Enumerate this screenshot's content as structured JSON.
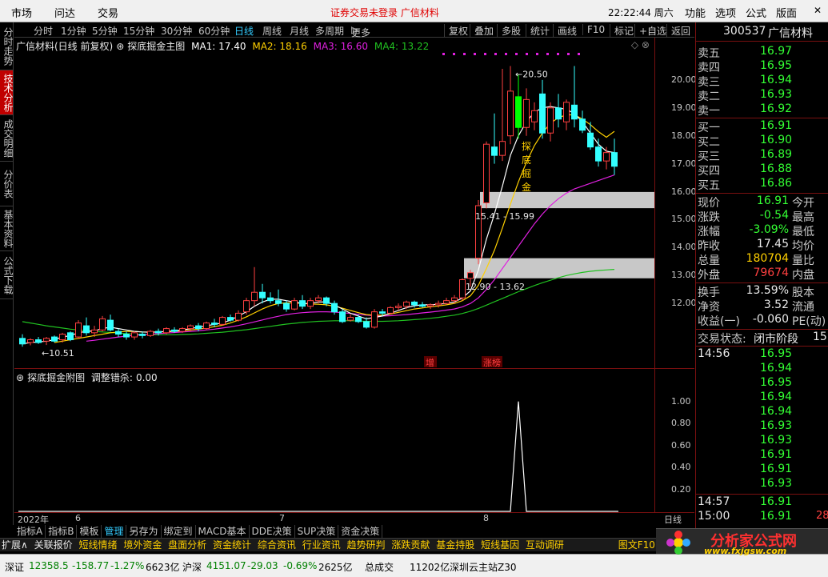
{
  "menu": {
    "items": [
      "市场",
      "问达",
      "交易"
    ],
    "notice": "证券交易未登录",
    "notice_stock": "广信材料",
    "clock": "22:22:44 周六",
    "right_items": [
      "功能",
      "选项",
      "公式",
      "版面"
    ]
  },
  "periods": [
    "分时",
    "1分钟",
    "5分钟",
    "15分钟",
    "30分钟",
    "60分钟",
    "日线",
    "周线",
    "月线",
    "多周期",
    "更多"
  ],
  "period_active": "日线",
  "toolbar_btns": [
    "复权",
    "叠加",
    "多股",
    "统计",
    "画线",
    "F10",
    "标记",
    "+自选",
    "返回"
  ],
  "left_tabs": [
    "分时走势",
    "技术分析",
    "成交明细",
    "分价表",
    "基本资料",
    "公式下载"
  ],
  "left_tab_active": "技术分析",
  "main_legend": {
    "title": "广信材料(日线 前复权)",
    "formula": "探底掘金主图",
    "ma1": "MA1: 17.40",
    "ma2": "MA2: 18.16",
    "ma3": "MA3: 16.60",
    "ma4": "MA4: 13.22"
  },
  "sub_legend": {
    "formula": "探底掘金附图",
    "value_label": "调整错杀:",
    "value": "0.00"
  },
  "annotations": {
    "high": "20.50",
    "low": "10.51",
    "band1": "15.41 - 15.99",
    "band2": "12.90 - 13.62",
    "signal": "探底掘金",
    "tag_zeng": "增",
    "tag_zhangbang": "涨榜"
  },
  "price_axis": [
    "20.00",
    "19.00",
    "18.00",
    "17.00",
    "16.00",
    "15.00",
    "14.00",
    "13.00",
    "12.00"
  ],
  "sub_axis": [
    "1.00",
    "0.80",
    "0.60",
    "0.40",
    "0.20"
  ],
  "date_axis": {
    "year": "2022年",
    "m6": "6",
    "m7": "7",
    "m8": "8",
    "period": "日线"
  },
  "index_tabs": [
    "指标A",
    "指标B",
    "模板",
    "管理",
    "另存为",
    "绑定到",
    "MACD基本",
    "DDE决策",
    "SUP决策",
    "资金决策"
  ],
  "index_tab_active": "管理",
  "info_tabs": [
    "扩展∧",
    "关联报价",
    "短线情绪",
    "境外资金",
    "盘面分析",
    "资金统计",
    "综合资讯",
    "行业资讯",
    "趋势研判",
    "涨跌贡献",
    "基金持股",
    "短线基因",
    "互动调研",
    "图文F10"
  ],
  "status": {
    "sz": "深证",
    "sz_val": "12358.5",
    "sz_chg": "-158.77",
    "sz_pct": "-1.27%",
    "sz_amt": "6623亿",
    "hs": "沪深",
    "hs_val": "4151.07",
    "hs_chg": "-29.03",
    "hs_pct": "-0.69%",
    "hs_amt": "2625亿",
    "total_label": "总成交",
    "total": "11202亿",
    "site": "深圳云主站Z30"
  },
  "quote": {
    "code": "300537",
    "name": "广信材料",
    "asks": [
      {
        "label": "卖五",
        "price": "16.97"
      },
      {
        "label": "卖四",
        "price": "16.95"
      },
      {
        "label": "卖三",
        "price": "16.94"
      },
      {
        "label": "卖二",
        "price": "16.93"
      },
      {
        "label": "卖一",
        "price": "16.92"
      }
    ],
    "bids": [
      {
        "label": "买一",
        "price": "16.91"
      },
      {
        "label": "买二",
        "price": "16.90"
      },
      {
        "label": "买三",
        "price": "16.89"
      },
      {
        "label": "买四",
        "price": "16.88"
      },
      {
        "label": "买五",
        "price": "16.86"
      }
    ],
    "stats": [
      {
        "label": "现价",
        "value": "16.91",
        "label2": "今开"
      },
      {
        "label": "涨跌",
        "value": "-0.54",
        "label2": "最高"
      },
      {
        "label": "涨幅",
        "value": "-3.09%",
        "label2": "最低"
      },
      {
        "label": "昨收",
        "value": "17.45",
        "label2": "均价"
      },
      {
        "label": "总量",
        "value": "180704",
        "label2": "量比"
      },
      {
        "label": "外盘",
        "value": "79674",
        "label2": "内盘"
      },
      {
        "label": "换手",
        "value": "13.59%",
        "label2": "股本"
      },
      {
        "label": "净资",
        "value": "3.52",
        "label2": "流通"
      },
      {
        "label": "收益(一)",
        "value": "-0.060",
        "label2": "PE(动)"
      }
    ],
    "trade_state_label": "交易状态:",
    "trade_state": "闭市阶段",
    "trade_state_extra": "15",
    "ticks": [
      {
        "time": "14:56",
        "price": "16.95"
      },
      {
        "time": "",
        "price": "16.94"
      },
      {
        "time": "",
        "price": "16.95"
      },
      {
        "time": "",
        "price": "16.94"
      },
      {
        "time": "",
        "price": "16.94"
      },
      {
        "time": "",
        "price": "16.93"
      },
      {
        "time": "",
        "price": "16.93"
      },
      {
        "time": "",
        "price": "16.91"
      },
      {
        "time": "",
        "price": "16.91"
      },
      {
        "time": "",
        "price": "16.93"
      },
      {
        "time": "14:57",
        "price": "16.91"
      },
      {
        "time": "15:00",
        "price": "16.91"
      }
    ],
    "last_vol": "28"
  },
  "watermark": {
    "title": "分析家公式网",
    "url": "www.fxjgsw.com"
  },
  "colors": {
    "up": "#ff4040",
    "down": "#33ffff",
    "ma1": "#ffffff",
    "ma2": "#ffd000",
    "ma3": "#e020e0",
    "ma4": "#20c020",
    "band": "#c8c8c8",
    "signal": "#00ff00"
  },
  "chart_data": {
    "type": "candlestick",
    "ylim": [
      10.2,
      21.0
    ],
    "candles": [
      {
        "o": 10.75,
        "h": 10.9,
        "l": 10.45,
        "c": 10.55
      },
      {
        "o": 10.6,
        "h": 10.75,
        "l": 10.5,
        "c": 10.7
      },
      {
        "o": 10.7,
        "h": 10.8,
        "l": 10.55,
        "c": 10.6
      },
      {
        "o": 10.65,
        "h": 10.8,
        "l": 10.51,
        "c": 10.75
      },
      {
        "o": 10.8,
        "h": 10.85,
        "l": 10.6,
        "c": 10.65
      },
      {
        "o": 10.7,
        "h": 10.95,
        "l": 10.6,
        "c": 10.9
      },
      {
        "o": 10.95,
        "h": 11.0,
        "l": 10.65,
        "c": 10.7
      },
      {
        "o": 10.8,
        "h": 11.4,
        "l": 10.75,
        "c": 11.3
      },
      {
        "o": 11.2,
        "h": 11.5,
        "l": 10.85,
        "c": 10.95
      },
      {
        "o": 10.95,
        "h": 11.2,
        "l": 10.8,
        "c": 11.05
      },
      {
        "o": 11.05,
        "h": 11.55,
        "l": 11.0,
        "c": 11.45
      },
      {
        "o": 11.4,
        "h": 11.6,
        "l": 11.0,
        "c": 11.05
      },
      {
        "o": 11.0,
        "h": 11.1,
        "l": 10.8,
        "c": 10.9
      },
      {
        "o": 10.9,
        "h": 11.0,
        "l": 10.7,
        "c": 10.8
      },
      {
        "o": 10.8,
        "h": 11.0,
        "l": 10.7,
        "c": 10.95
      },
      {
        "o": 10.9,
        "h": 11.0,
        "l": 10.75,
        "c": 10.85
      },
      {
        "o": 10.85,
        "h": 11.05,
        "l": 10.8,
        "c": 11.0
      },
      {
        "o": 11.0,
        "h": 11.1,
        "l": 10.85,
        "c": 10.95
      },
      {
        "o": 10.95,
        "h": 11.15,
        "l": 10.9,
        "c": 11.1
      },
      {
        "o": 11.05,
        "h": 11.15,
        "l": 10.95,
        "c": 11.0
      },
      {
        "o": 11.0,
        "h": 11.15,
        "l": 10.95,
        "c": 11.1
      },
      {
        "o": 11.1,
        "h": 11.25,
        "l": 11.0,
        "c": 11.2
      },
      {
        "o": 11.2,
        "h": 11.3,
        "l": 11.0,
        "c": 11.1
      },
      {
        "o": 11.1,
        "h": 11.35,
        "l": 11.05,
        "c": 11.3
      },
      {
        "o": 11.3,
        "h": 11.45,
        "l": 11.15,
        "c": 11.25
      },
      {
        "o": 11.25,
        "h": 11.55,
        "l": 11.2,
        "c": 11.5
      },
      {
        "o": 11.5,
        "h": 11.6,
        "l": 11.35,
        "c": 11.4
      },
      {
        "o": 11.4,
        "h": 11.75,
        "l": 11.35,
        "c": 11.65
      },
      {
        "o": 11.7,
        "h": 12.2,
        "l": 11.6,
        "c": 12.1
      },
      {
        "o": 12.1,
        "h": 13.3,
        "l": 11.9,
        "c": 12.4
      },
      {
        "o": 12.4,
        "h": 12.7,
        "l": 12.0,
        "c": 12.2
      },
      {
        "o": 12.2,
        "h": 12.4,
        "l": 12.0,
        "c": 12.1
      },
      {
        "o": 12.1,
        "h": 12.5,
        "l": 11.9,
        "c": 12.0
      },
      {
        "o": 12.0,
        "h": 12.1,
        "l": 11.7,
        "c": 11.8
      },
      {
        "o": 11.8,
        "h": 12.2,
        "l": 11.75,
        "c": 12.1
      },
      {
        "o": 12.1,
        "h": 12.3,
        "l": 11.8,
        "c": 11.9
      },
      {
        "o": 11.9,
        "h": 12.2,
        "l": 11.8,
        "c": 12.1
      },
      {
        "o": 12.1,
        "h": 12.3,
        "l": 12.0,
        "c": 12.2
      },
      {
        "o": 12.2,
        "h": 12.25,
        "l": 11.9,
        "c": 12.0
      },
      {
        "o": 12.0,
        "h": 12.1,
        "l": 11.6,
        "c": 11.7
      },
      {
        "o": 11.7,
        "h": 11.8,
        "l": 11.3,
        "c": 11.35
      },
      {
        "o": 11.4,
        "h": 11.6,
        "l": 11.35,
        "c": 11.5
      },
      {
        "o": 11.5,
        "h": 11.6,
        "l": 11.3,
        "c": 11.35
      },
      {
        "o": 11.35,
        "h": 11.5,
        "l": 11.1,
        "c": 11.15
      },
      {
        "o": 11.15,
        "h": 11.8,
        "l": 11.1,
        "c": 11.7
      },
      {
        "o": 11.7,
        "h": 11.8,
        "l": 11.55,
        "c": 11.65
      },
      {
        "o": 11.65,
        "h": 11.9,
        "l": 11.6,
        "c": 11.85
      },
      {
        "o": 11.85,
        "h": 12.0,
        "l": 11.75,
        "c": 11.9
      },
      {
        "o": 11.9,
        "h": 12.1,
        "l": 11.8,
        "c": 12.05
      },
      {
        "o": 12.05,
        "h": 12.1,
        "l": 11.85,
        "c": 11.95
      },
      {
        "o": 11.95,
        "h": 12.05,
        "l": 11.85,
        "c": 11.9
      },
      {
        "o": 11.9,
        "h": 12.0,
        "l": 11.8,
        "c": 11.95
      },
      {
        "o": 11.95,
        "h": 12.1,
        "l": 11.85,
        "c": 12.0
      },
      {
        "o": 12.0,
        "h": 12.2,
        "l": 11.95,
        "c": 12.1
      },
      {
        "o": 12.1,
        "h": 12.3,
        "l": 12.0,
        "c": 12.2
      },
      {
        "o": 12.2,
        "h": 12.9,
        "l": 12.1,
        "c": 12.85
      },
      {
        "o": 12.9,
        "h": 13.2,
        "l": 12.6,
        "c": 13.1
      },
      {
        "o": 13.62,
        "h": 15.7,
        "l": 13.4,
        "c": 15.5
      },
      {
        "o": 15.6,
        "h": 17.8,
        "l": 15.4,
        "c": 17.7
      },
      {
        "o": 17.6,
        "h": 18.8,
        "l": 17.0,
        "c": 17.3
      },
      {
        "o": 17.3,
        "h": 20.4,
        "l": 17.1,
        "c": 17.8
      },
      {
        "o": 18.0,
        "h": 20.5,
        "l": 17.7,
        "c": 19.6
      },
      {
        "o": 19.4,
        "h": 20.2,
        "l": 17.9,
        "c": 18.3
      },
      {
        "o": 18.3,
        "h": 19.7,
        "l": 18.0,
        "c": 19.3
      },
      {
        "o": 18.5,
        "h": 19.2,
        "l": 18.2,
        "c": 18.9
      },
      {
        "o": 19.5,
        "h": 20.0,
        "l": 17.9,
        "c": 18.1
      },
      {
        "o": 18.1,
        "h": 19.2,
        "l": 17.8,
        "c": 19.0
      },
      {
        "o": 19.0,
        "h": 19.5,
        "l": 18.3,
        "c": 18.6
      },
      {
        "o": 18.5,
        "h": 19.3,
        "l": 18.2,
        "c": 19.2
      },
      {
        "o": 19.1,
        "h": 20.5,
        "l": 18.3,
        "c": 18.6
      },
      {
        "o": 18.6,
        "h": 18.9,
        "l": 18.1,
        "c": 18.2
      },
      {
        "o": 18.1,
        "h": 18.5,
        "l": 17.5,
        "c": 17.6
      },
      {
        "o": 17.6,
        "h": 17.9,
        "l": 16.9,
        "c": 17.1
      },
      {
        "o": 17.1,
        "h": 17.6,
        "l": 16.8,
        "c": 17.4
      },
      {
        "o": 17.4,
        "h": 17.9,
        "l": 16.6,
        "c": 16.91
      }
    ],
    "signal_index": 62,
    "ma1": [
      10.55,
      10.6,
      10.62,
      10.65,
      10.7,
      10.8,
      10.85,
      10.95,
      11.0,
      11.02,
      11.1,
      11.15,
      11.1,
      11.05,
      11.0,
      10.98,
      10.97,
      10.98,
      11.0,
      11.02,
      11.05,
      11.1,
      11.15,
      11.2,
      11.25,
      11.3,
      11.4,
      11.55,
      11.7,
      11.9,
      12.05,
      12.15,
      12.15,
      12.1,
      12.05,
      12.0,
      12.0,
      12.05,
      12.05,
      11.95,
      11.8,
      11.65,
      11.55,
      11.45,
      11.5,
      11.55,
      11.65,
      11.75,
      11.85,
      11.92,
      11.95,
      11.95,
      11.97,
      12.0,
      12.05,
      12.2,
      12.45,
      13.2,
      14.3,
      15.2,
      16.2,
      17.3,
      18.0,
      18.5,
      18.85,
      19.0,
      19.05,
      19.0,
      18.95,
      18.8,
      18.5,
      18.1,
      17.7,
      17.45,
      17.4
    ],
    "ma2": [
      null,
      null,
      null,
      null,
      10.6,
      10.65,
      10.7,
      10.75,
      10.8,
      10.85,
      10.9,
      10.95,
      10.98,
      11.0,
      11.0,
      10.98,
      10.97,
      10.98,
      10.99,
      11.0,
      11.02,
      11.05,
      11.08,
      11.12,
      11.17,
      11.22,
      11.3,
      11.4,
      11.52,
      11.66,
      11.8,
      11.92,
      12.0,
      12.02,
      12.02,
      12.0,
      11.98,
      11.97,
      11.95,
      11.9,
      11.83,
      11.75,
      11.67,
      11.6,
      11.58,
      11.58,
      11.62,
      11.68,
      11.74,
      11.8,
      11.84,
      11.88,
      11.91,
      11.95,
      12.0,
      12.1,
      12.27,
      12.65,
      13.25,
      13.9,
      14.7,
      15.55,
      16.35,
      17.05,
      17.65,
      18.1,
      18.45,
      18.65,
      18.75,
      18.75,
      18.6,
      18.4,
      18.15,
      17.95,
      18.16
    ],
    "ma3": [
      null,
      null,
      null,
      null,
      null,
      null,
      null,
      null,
      10.65,
      10.68,
      10.72,
      10.76,
      10.8,
      10.83,
      10.86,
      10.88,
      10.9,
      10.92,
      10.94,
      10.96,
      10.98,
      11.0,
      11.02,
      11.05,
      11.08,
      11.12,
      11.16,
      11.21,
      11.27,
      11.34,
      11.41,
      11.48,
      11.54,
      11.6,
      11.64,
      11.67,
      11.69,
      11.7,
      11.7,
      11.69,
      11.67,
      11.64,
      11.61,
      11.58,
      11.56,
      11.55,
      11.56,
      11.58,
      11.6,
      11.63,
      11.66,
      11.69,
      11.72,
      11.76,
      11.8,
      11.88,
      12.0,
      12.2,
      12.5,
      12.85,
      13.25,
      13.65,
      14.05,
      14.45,
      14.85,
      15.2,
      15.5,
      15.75,
      15.95,
      16.1,
      16.2,
      16.3,
      16.4,
      16.5,
      16.6
    ],
    "ma4": [
      11.35,
      11.3,
      11.25,
      11.2,
      11.16,
      11.12,
      11.08,
      11.05,
      11.02,
      11.0,
      10.98,
      10.96,
      10.94,
      10.92,
      10.9,
      10.89,
      10.88,
      10.88,
      10.88,
      10.88,
      10.89,
      10.9,
      10.91,
      10.93,
      10.95,
      10.97,
      11.0,
      11.03,
      11.06,
      11.1,
      11.14,
      11.18,
      11.22,
      11.26,
      11.29,
      11.32,
      11.34,
      11.36,
      11.37,
      11.38,
      11.38,
      11.38,
      11.37,
      11.36,
      11.36,
      11.36,
      11.37,
      11.38,
      11.4,
      11.42,
      11.44,
      11.47,
      11.5,
      11.54,
      11.58,
      11.64,
      11.72,
      11.82,
      11.94,
      12.06,
      12.18,
      12.3,
      12.42,
      12.53,
      12.64,
      12.74,
      12.83,
      12.92,
      13.0,
      13.06,
      13.11,
      13.15,
      13.18,
      13.2,
      13.22
    ],
    "bands": [
      [
        15.41,
        15.99
      ],
      [
        12.9,
        13.62
      ]
    ],
    "sub_series": {
      "name": "调整错杀",
      "ylim": [
        0,
        1.15
      ],
      "peak_index": 62,
      "peak_value": 1.0
    }
  }
}
